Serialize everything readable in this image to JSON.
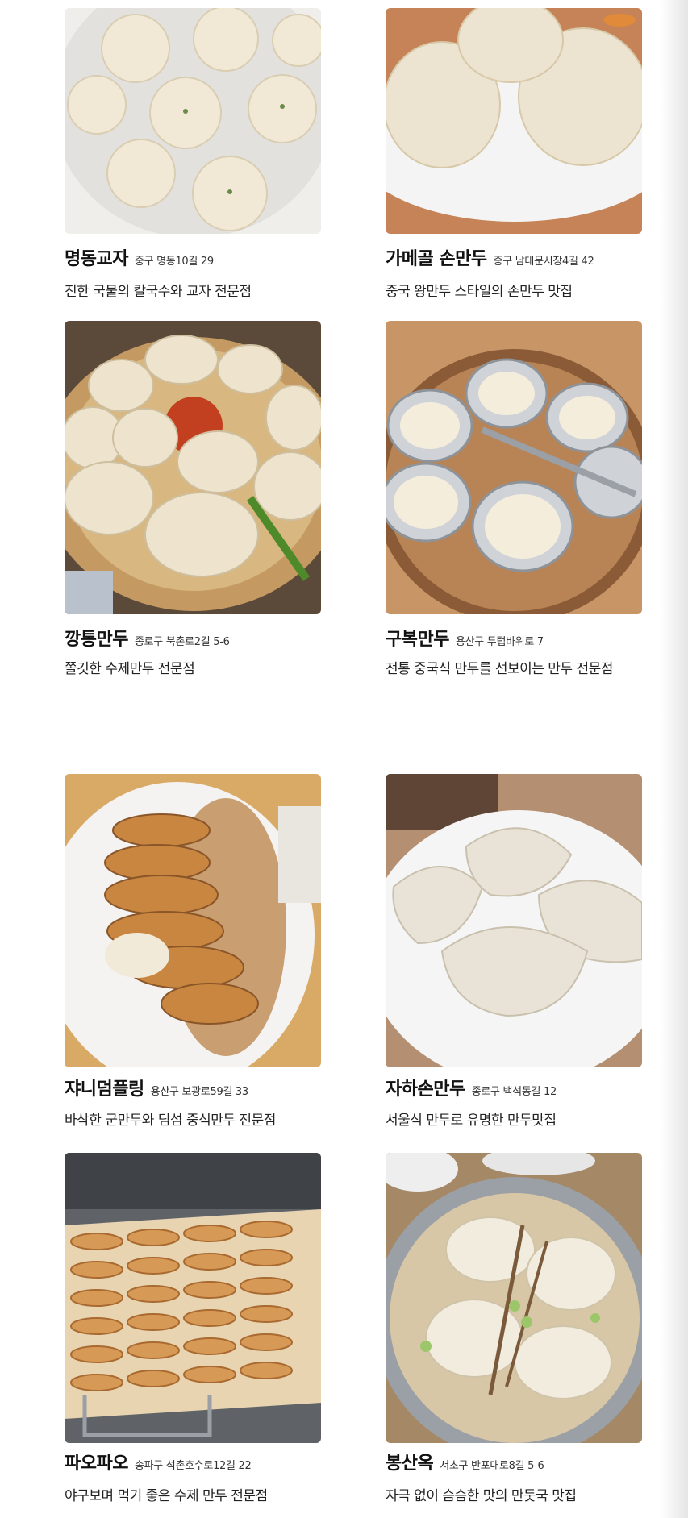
{
  "restaurants": [
    {
      "name": "명동교자",
      "address": "중구 명동10길 29",
      "description": "진한 국물의 칼국수와 교자 전문점",
      "image": "steamed-dumplings-on-steamer-icon",
      "colors": {
        "bg": "#e9e7e4",
        "food": "#f2ecdc"
      }
    },
    {
      "name": "가메골 손만두",
      "address": "중구 남대문시장4길 42",
      "description": "중국 왕만두 스타일의 손만두 맛집",
      "image": "large-steamed-buns-icon",
      "colors": {
        "bg": "#c7825a",
        "food": "#efe6d6"
      }
    },
    {
      "name": "깡통만두",
      "address": "종로구 북촌로2길 5-6",
      "description": "쫄깃한 수제만두 전문점",
      "image": "dumpling-platter-with-kimchi-icon",
      "colors": {
        "bg": "#8a6f55",
        "food": "#efe6d2"
      }
    },
    {
      "name": "구복만두",
      "address": "용산구 두텁바위로 7",
      "description": "전통 중국식 만두를 선보이는 만두 전문점",
      "image": "xiaolongbao-in-bamboo-steamer-icon",
      "colors": {
        "bg": "#b8865a",
        "food": "#f3ead8"
      }
    },
    {
      "name": "쟈니덤플링",
      "address": "용산구 보광로59길 33",
      "description": "바삭한 군만두와 딤섬 중식만두 전문점",
      "image": "pan-fried-dumplings-icon",
      "colors": {
        "bg": "#d2a55f",
        "food": "#c98a3c"
      }
    },
    {
      "name": "자하손만두",
      "address": "종로구 백석동길 12",
      "description": "서울식 만두로 유명한 만두맛집",
      "image": "hand-folded-dumplings-on-plate-icon",
      "colors": {
        "bg": "#b89276",
        "food": "#ece7dc"
      }
    },
    {
      "name": "파오파오",
      "address": "송파구 석촌호수로12길 22",
      "description": "야구보며 먹기 좋은 수제 만두 전문점",
      "image": "rows-of-gyoza-on-rack-icon",
      "colors": {
        "bg": "#6b6f74",
        "food": "#d99a55"
      }
    },
    {
      "name": "봉산옥",
      "address": "서초구 반포대로8길 5-6",
      "description": "자극 없이 슴슴한 맛의 만둣국 맛집",
      "image": "dumpling-soup-bowl-icon",
      "colors": {
        "bg": "#a98c6a",
        "food": "#efe7d6"
      }
    }
  ]
}
